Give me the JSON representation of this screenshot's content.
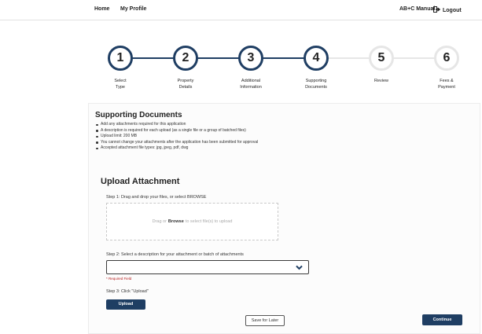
{
  "nav": {
    "home": "Home",
    "profile": "My Profile",
    "manual": "AB+C Manual",
    "logout": "Logout"
  },
  "steps": [
    {
      "number": "1",
      "line1": "Select",
      "line2": "Type",
      "state": "done"
    },
    {
      "number": "2",
      "line1": "Property",
      "line2": "Details",
      "state": "done"
    },
    {
      "number": "3",
      "line1": "Additional",
      "line2": "Information",
      "state": "done"
    },
    {
      "number": "4",
      "line1": "Supporting",
      "line2": "Documents",
      "state": "current"
    },
    {
      "number": "5",
      "line1": "Review",
      "line2": "",
      "state": "todo"
    },
    {
      "number": "6",
      "line1": "Fees &",
      "line2": "Payment",
      "state": "todo"
    }
  ],
  "colors": {
    "primary": "#1f3e63",
    "inactive": "#e6e6e6",
    "required": "#b51b1b"
  },
  "documents": {
    "title": "Supporting Documents",
    "bullets": [
      "Add any attachments required for this application",
      "A description is required for each upload (as a single file or a group of batched files)",
      "Upload limit: 200 MB",
      "You cannot change your attachments after the application has been submitted for approval",
      "Accepted attachment file types: jpg, jpeg, pdf, dwg"
    ]
  },
  "upload": {
    "title": "Upload Attachment",
    "step1": "Step 1: Drag and drop your files, or select BROWSE",
    "drop_prefix": "Drag or",
    "drop_browse": "Browse",
    "drop_suffix": "to select file(s) to upload",
    "step2": "Step 2: Select a description for your attachment or batch of attachments",
    "description_value": "",
    "required": "* Required Field",
    "step3": "Step 3: Click \"Upload\"",
    "upload_button": "Upload"
  },
  "actions": {
    "save": "Save for Later",
    "continue": "Continue"
  },
  "icons": {
    "logout": "sign-out-icon",
    "select": "chevron-down-icon"
  }
}
